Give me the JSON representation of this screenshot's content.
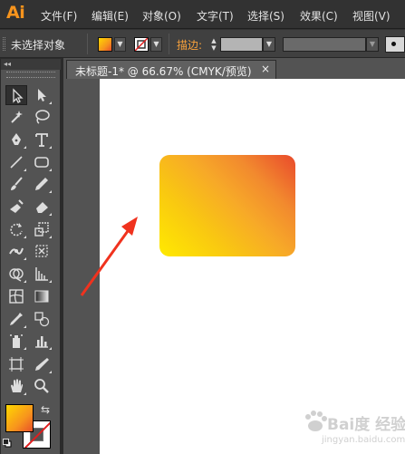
{
  "app": {
    "logo": "Ai",
    "brand_color": "#f7941d"
  },
  "menu": [
    "文件(F)",
    "编辑(E)",
    "对象(O)",
    "文字(T)",
    "选择(S)",
    "效果(C)",
    "视图(V)"
  ],
  "control_bar": {
    "selection_label": "未选择对象",
    "stroke_label": "描边:",
    "fill_icon": "gradient-fill-swatch",
    "stroke_icon": "no-stroke-swatch"
  },
  "document": {
    "tab_title": "未标题-1* @ 66.67% (CMYK/预览)",
    "close_label": "×"
  },
  "artwork": {
    "shape": "rounded-rectangle",
    "gradient_colors": [
      "#ffea00",
      "#f7a928",
      "#e94a2c"
    ],
    "annotation": "red-arrow"
  },
  "toolbar": {
    "header": "◂◂",
    "tools": [
      "selection-tool-icon",
      "direct-selection-tool-icon",
      "magic-wand-tool-icon",
      "lasso-tool-icon",
      "pen-tool-icon",
      "type-tool-icon",
      "line-segment-tool-icon",
      "rectangle-tool-icon",
      "paintbrush-tool-icon",
      "pencil-tool-icon",
      "blob-brush-tool-icon",
      "eraser-tool-icon",
      "rotate-tool-icon",
      "scale-tool-icon",
      "width-tool-icon",
      "free-transform-tool-icon",
      "shape-builder-tool-icon",
      "perspective-grid-tool-icon",
      "mesh-tool-icon",
      "gradient-tool-icon",
      "eyedropper-tool-icon",
      "blend-tool-icon",
      "symbol-sprayer-tool-icon",
      "column-graph-tool-icon",
      "artboard-tool-icon",
      "slice-tool-icon",
      "hand-tool-icon",
      "zoom-tool-icon"
    ]
  },
  "watermark": {
    "text": "Bai度 经验",
    "url": "jingyan.baidu.com"
  }
}
